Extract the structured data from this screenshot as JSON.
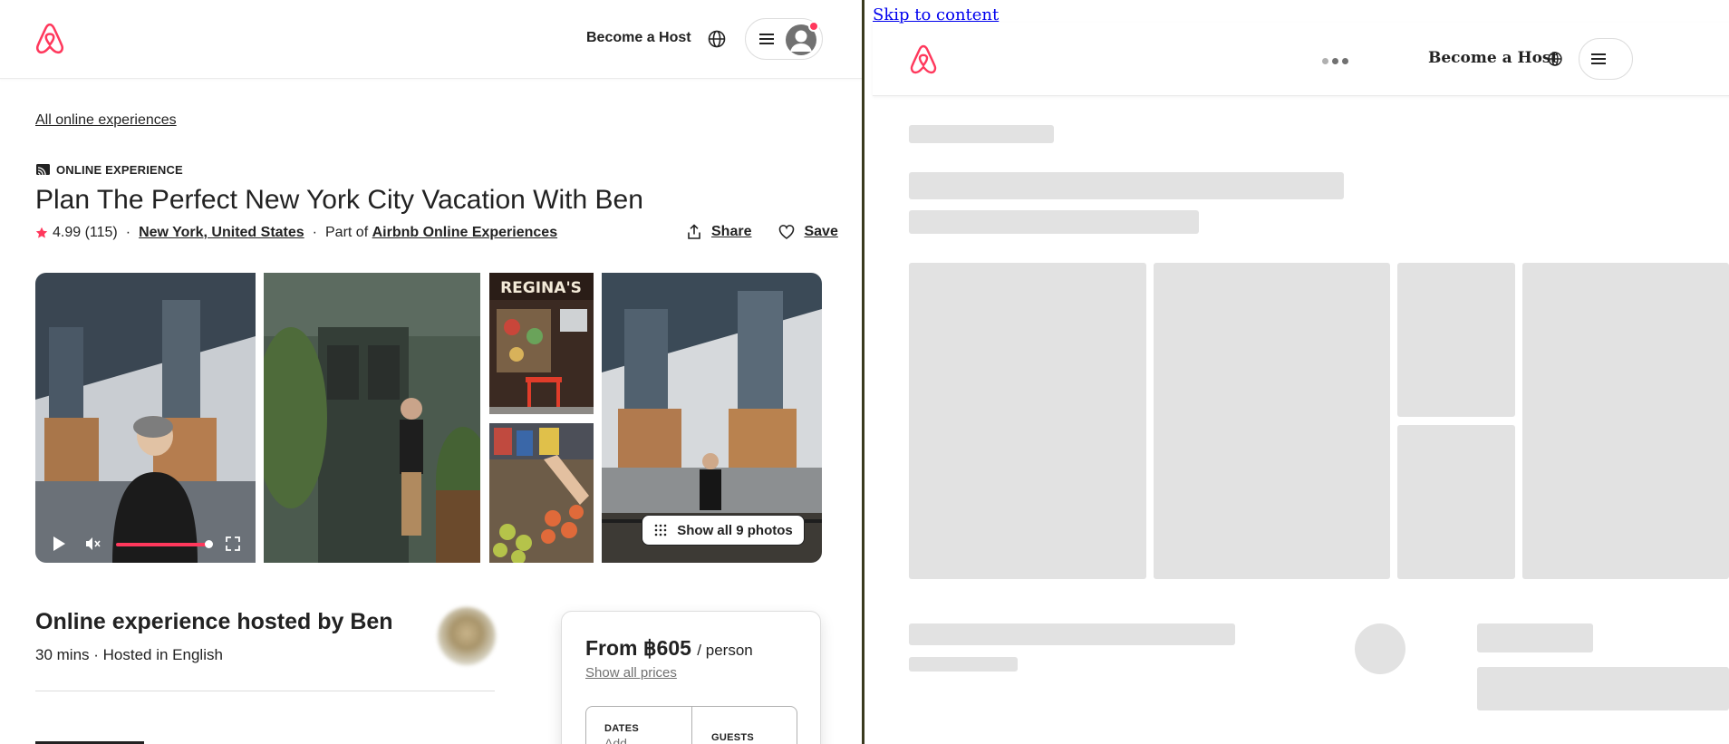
{
  "brand": {
    "accent": "#ff385c",
    "skeleton": "#e2e2e2"
  },
  "left": {
    "header": {
      "host_label": "Become a Host",
      "globe_icon": "globe-icon",
      "menu_icon": "hamburger-menu-icon",
      "avatar_icon": "user-avatar-icon"
    },
    "breadcrumb": "All online experiences",
    "kicker": "ONLINE EXPERIENCE",
    "title": "Plan The Perfect New York City Vacation With Ben",
    "rating": "4.99",
    "reviews": "(115)",
    "location": "New York, United States",
    "part_of_prefix": "Part of",
    "part_of_link": "Airbnb Online Experiences",
    "share_label": "Share",
    "save_label": "Save",
    "photos": {
      "show_all_label": "Show all 9 photos",
      "video_progress": 0.85
    },
    "hosted_by": "Online experience hosted by Ben",
    "details": "30 mins · Hosted in English",
    "price": {
      "from": "From ฿605",
      "per": "/ person",
      "show_all_prices": "Show all prices",
      "dates_label": "DATES",
      "dates_value": "Add",
      "guests_label": "GUESTS"
    }
  },
  "right": {
    "skip_link": "Skip to content",
    "host_label": "Become a Host"
  }
}
